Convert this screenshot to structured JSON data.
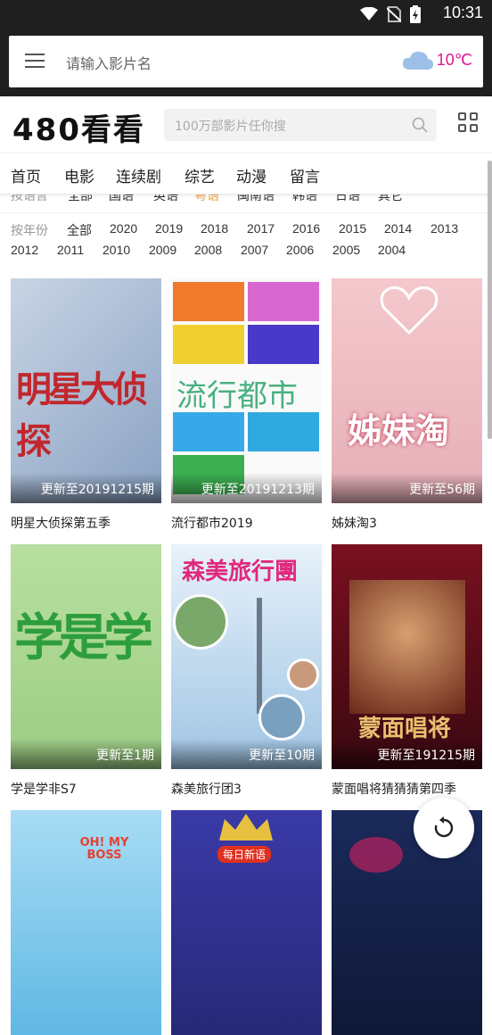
{
  "status_bar": {
    "time": "10:31"
  },
  "browser": {
    "search_placeholder": "请输入影片名",
    "temperature": "10℃",
    "accent": "#e0188c"
  },
  "site": {
    "logo": "480看看",
    "search_placeholder": "100万部影片任你搜"
  },
  "nav": {
    "items": [
      "首页",
      "电影",
      "连续剧",
      "综艺",
      "动漫",
      "留言"
    ]
  },
  "language_filter": {
    "label": "按语言",
    "options": [
      "全部",
      "国语",
      "英语",
      "粤语",
      "闽南语",
      "韩语",
      "日语",
      "其它"
    ]
  },
  "year_filter": {
    "label": "按年份",
    "row1": [
      "全部",
      "2020",
      "2019",
      "2018",
      "2017",
      "2016",
      "2015",
      "2014",
      "2013"
    ],
    "row2": [
      "2012",
      "2011",
      "2010",
      "2009",
      "2008",
      "2007",
      "2006",
      "2005",
      "2004"
    ]
  },
  "cards": [
    {
      "title": "明星大侦探第五季",
      "badge": "更新至20191215期",
      "art": "明星大侦探"
    },
    {
      "title": "流行都市2019",
      "badge": "更新至20191213期",
      "art": "流行都市"
    },
    {
      "title": "姊妹淘3",
      "badge": "更新至56期",
      "art": "姊妹淘"
    },
    {
      "title": "学是学非S7",
      "badge": "更新至1期",
      "art": "学是学"
    },
    {
      "title": "森美旅行团3",
      "badge": "更新至10期",
      "art": "森美旅行團"
    },
    {
      "title": "蒙面唱将猜猜猜第四季",
      "badge": "更新至191215期",
      "art": "蒙面唱将"
    },
    {
      "title": "",
      "badge": "",
      "art": "OH! MY BOSS"
    },
    {
      "title": "",
      "badge": "",
      "art": "每日新语"
    },
    {
      "title": "",
      "badge": "",
      "art": ""
    }
  ]
}
